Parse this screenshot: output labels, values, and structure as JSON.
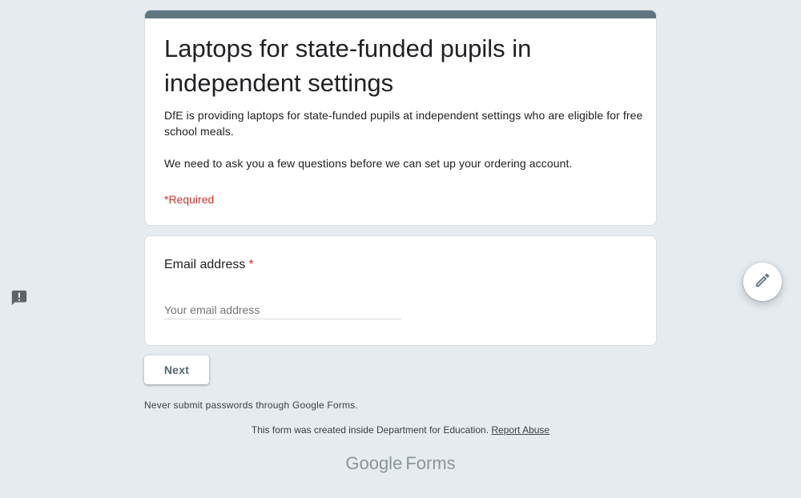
{
  "form": {
    "title": "Laptops for state-funded pupils in independent settings",
    "description_lines": [
      "DfE is providing laptops for state-funded pupils at independent settings who are eligible for free school meals.",
      "We need to ask you a few questions before we can set up your ordering account."
    ],
    "required_note": "*Required",
    "header_color": "#5f7681"
  },
  "question": {
    "label": "Email address",
    "required_marker": "*",
    "input_value": "",
    "input_placeholder": "Your email address"
  },
  "actions": {
    "next_label": "Next"
  },
  "footer": {
    "password_warning": "Never submit passwords through Google Forms.",
    "created_text": "This form was created inside Department for Education.",
    "report_abuse_label": "Report Abuse",
    "logo_google": "Google",
    "logo_forms": "Forms"
  },
  "icons": {
    "feedback": "feedback-icon",
    "edit": "pencil-icon"
  },
  "colors": {
    "background": "#e6ebef",
    "accent": "#5f7681",
    "required": "#d93025"
  }
}
